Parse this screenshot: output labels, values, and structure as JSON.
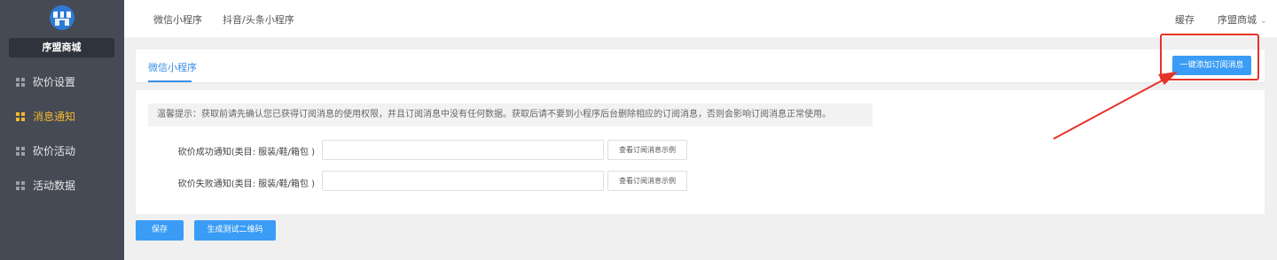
{
  "sidebar": {
    "shop_name": "序盟商城",
    "logo_icon": "shop-icon",
    "items": [
      {
        "label": "砍价设置",
        "icon": "grid-icon",
        "active": false
      },
      {
        "label": "消息通知",
        "icon": "grid-icon",
        "active": true
      },
      {
        "label": "砍价活动",
        "icon": "grid-icon",
        "active": false
      },
      {
        "label": "活动数据",
        "icon": "grid-icon",
        "active": false
      }
    ],
    "active_color": "#f5b82e"
  },
  "topbar": {
    "tabs": [
      "微信小程序",
      "抖音/头条小程序"
    ],
    "cache_label": "缓存",
    "account_label": "序盟商城",
    "account_icon": "chevron-down-icon"
  },
  "main": {
    "tab_label": "微信小程序",
    "add_button": "一键添加订阅消息",
    "tip": "温馨提示：获取前请先确认您已获得订阅消息的使用权限，并且订阅消息中没有任何数据。获取后请不要到小程序后台删除相应的订阅消息，否则会影响订阅消息正常使用。",
    "fields": [
      {
        "label": "砍价成功通知(类目: 服装/鞋/箱包 )",
        "value": "",
        "example_button": "查看订阅消息示例"
      },
      {
        "label": "砍价失败通知(类目: 服装/鞋/箱包 )",
        "value": "",
        "example_button": "查看订阅消息示例"
      }
    ],
    "save_button": "保存",
    "qr_button": "生成测试二维码"
  },
  "colors": {
    "primary": "#3a9cf5",
    "annotation": "#e5332a",
    "sidebar_bg": "#454a54"
  }
}
